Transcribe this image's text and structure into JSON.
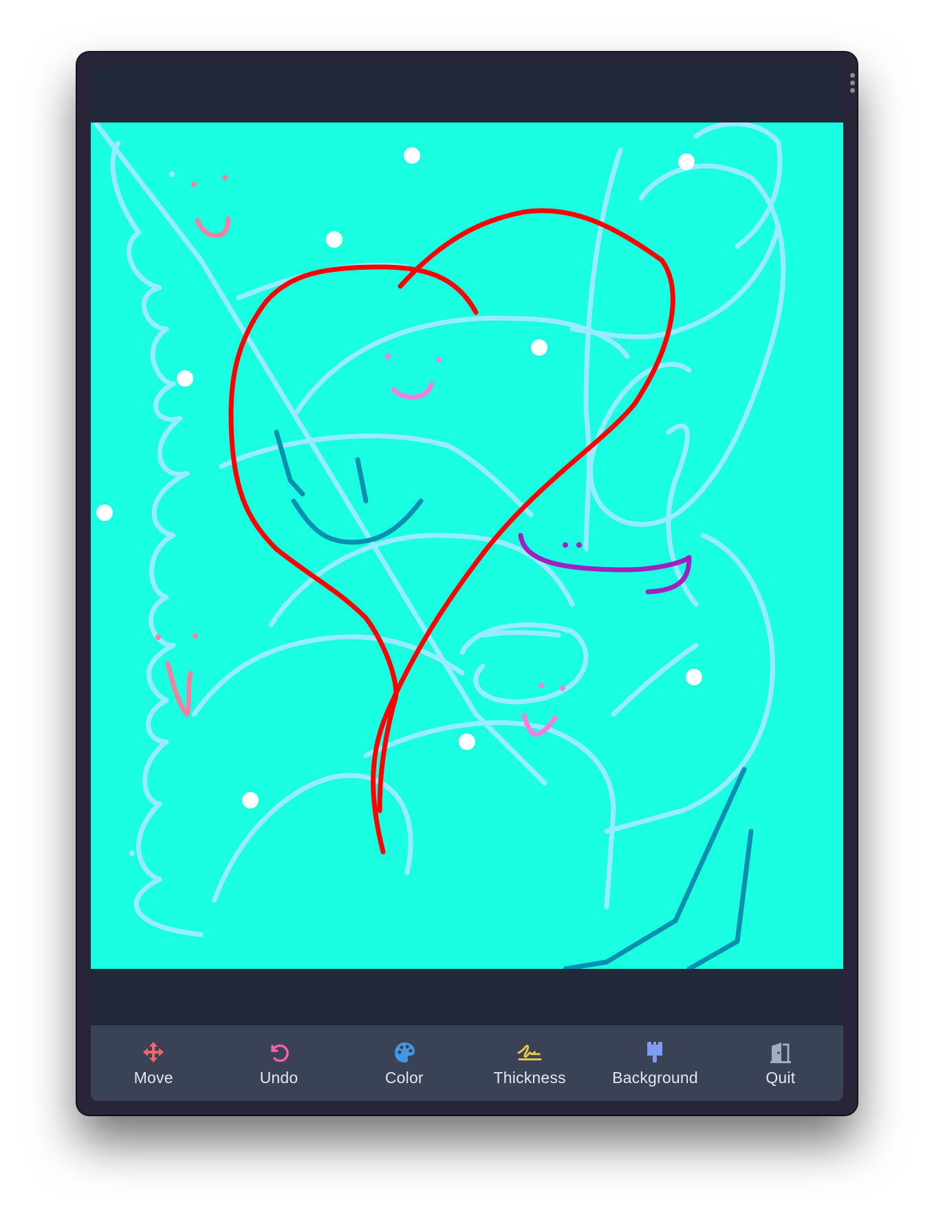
{
  "toolbar": {
    "items": [
      {
        "label": "Move",
        "icon": "move-arrows-icon",
        "color": "#f56565"
      },
      {
        "label": "Undo",
        "icon": "undo-icon",
        "color": "#ed64a6"
      },
      {
        "label": "Color",
        "icon": "palette-icon",
        "color": "#4299e1"
      },
      {
        "label": "Thickness",
        "icon": "signature-icon",
        "color": "#ecc94b"
      },
      {
        "label": "Background",
        "icon": "paint-brush-icon",
        "color": "#7f9cf5"
      },
      {
        "label": "Quit",
        "icon": "door-exit-icon",
        "color": "#a0aec0"
      }
    ]
  },
  "canvas": {
    "background": "#1affe2",
    "strokes": [
      "#ff0000",
      "#99ecff",
      "#0a8fb0",
      "#a020c0",
      "#f280a0",
      "#f080e0"
    ],
    "dots": "#ffffff"
  }
}
